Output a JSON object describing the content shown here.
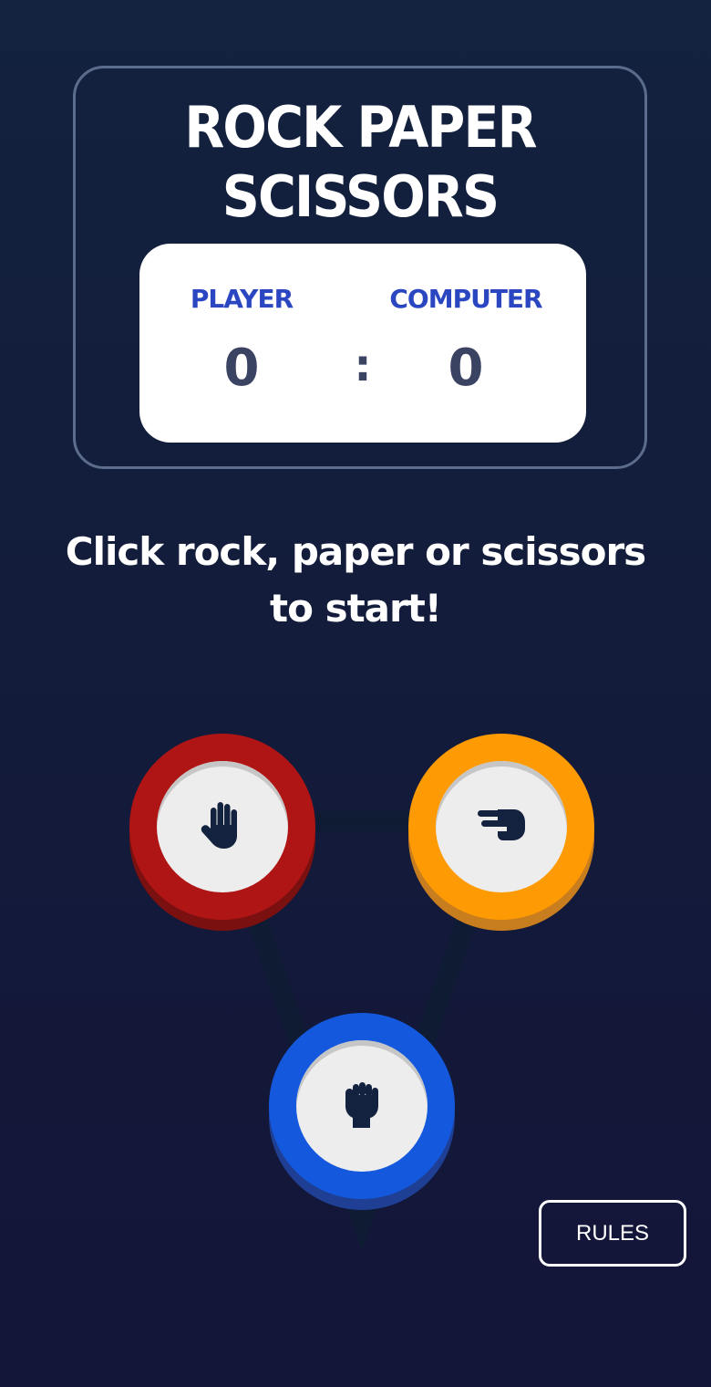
{
  "header": {
    "title_line_1": "ROCK PAPER",
    "title_line_2": "SCISSORS"
  },
  "scoreboard": {
    "player_label": "PLAYER",
    "computer_label": "COMPUTER",
    "player_score": "0",
    "separator": ":",
    "computer_score": "0"
  },
  "instruction": "Click rock, paper or scissors to start!",
  "choices": [
    {
      "name": "paper",
      "icon": "hand-paper-icon",
      "color": "#b01515"
    },
    {
      "name": "scissors",
      "icon": "hand-scissors-icon",
      "color": "#fd9a04"
    },
    {
      "name": "rock",
      "icon": "hand-rock-icon",
      "color": "#1459dd"
    }
  ],
  "rules_button": "RULES",
  "colors": {
    "background": "#13223e",
    "score_label": "#2a46c0",
    "score_value": "#3b4363"
  }
}
